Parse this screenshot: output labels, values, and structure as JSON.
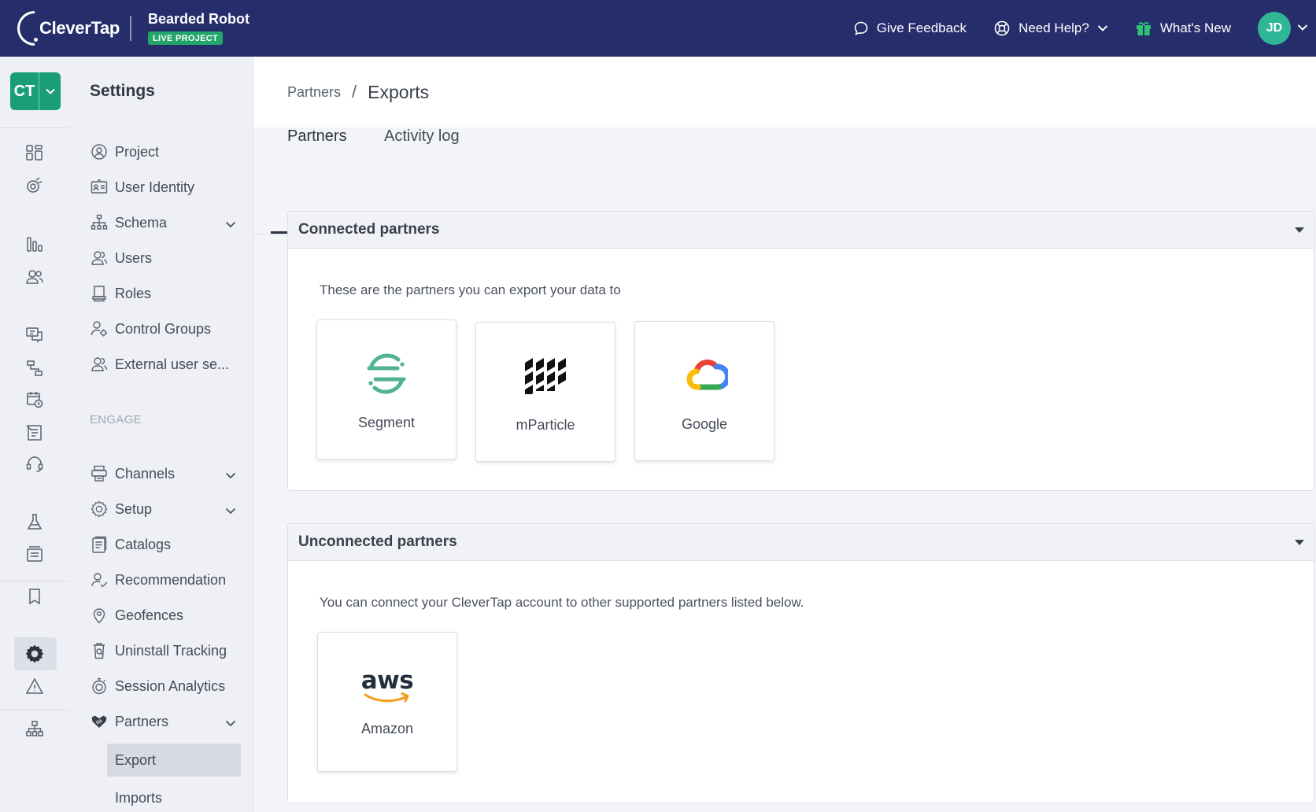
{
  "header": {
    "brand": "CleverTap",
    "project_name": "Bearded Robot",
    "project_badge": "LIVE PROJECT",
    "feedback_label": "Give Feedback",
    "help_label": "Need Help?",
    "whats_new_label": "What's New",
    "avatar_initials": "JD"
  },
  "rail": {
    "account_switch": "CT",
    "icons": [
      "dashboard-icon",
      "segments-icon",
      "analytics-icon",
      "users-icon",
      "messages-icon",
      "journeys-icon",
      "campaign-calendar-icon",
      "campaigns-icon",
      "support-icon",
      "experiments-icon",
      "catalog-icon",
      "bookmark-icon",
      "settings-icon",
      "alert-icon",
      "hierarchy-icon"
    ],
    "active_icon": "settings-icon"
  },
  "sidebar": {
    "title": "Settings",
    "items": [
      {
        "label": "Project",
        "icon": "project-icon"
      },
      {
        "label": "User Identity",
        "icon": "id-card-icon"
      },
      {
        "label": "Schema",
        "icon": "schema-icon",
        "expandable": true
      },
      {
        "label": "Users",
        "icon": "users-icon"
      },
      {
        "label": "Roles",
        "icon": "roles-icon"
      },
      {
        "label": "Control Groups",
        "icon": "control-groups-icon"
      },
      {
        "label": "External user se...",
        "icon": "external-users-icon"
      }
    ],
    "section_engage": "ENGAGE",
    "engage_items": [
      {
        "label": "Channels",
        "icon": "channels-icon",
        "expandable": true
      },
      {
        "label": "Setup",
        "icon": "gear-icon",
        "expandable": true
      },
      {
        "label": "Catalogs",
        "icon": "catalogs-icon"
      },
      {
        "label": "Recommendation",
        "icon": "recommendation-icon"
      },
      {
        "label": "Geofences",
        "icon": "location-pin-icon"
      },
      {
        "label": "Uninstall Tracking",
        "icon": "uninstall-icon"
      },
      {
        "label": "Session Analytics",
        "icon": "stopwatch-icon"
      },
      {
        "label": "Partners",
        "icon": "handshake-icon",
        "expandable": true
      }
    ],
    "partner_subitems": [
      {
        "label": "Export",
        "active": true
      },
      {
        "label": "Imports",
        "active": false
      }
    ]
  },
  "main": {
    "breadcrumb_parent": "Partners",
    "breadcrumb_sep": "/",
    "breadcrumb_current": "Exports",
    "tabs": [
      {
        "label": "Partners",
        "active": true
      },
      {
        "label": "Activity log",
        "active": false
      }
    ],
    "connected": {
      "title": "Connected partners",
      "description": "These are the partners you can export your data to",
      "partners": [
        {
          "name": "Segment",
          "logo": "segment-logo"
        },
        {
          "name": "mParticle",
          "logo": "mparticle-logo"
        },
        {
          "name": "Google",
          "logo": "google-cloud-logo"
        }
      ]
    },
    "unconnected": {
      "title": "Unconnected partners",
      "description": "You can connect your CleverTap account to other supported partners listed below.",
      "partners": [
        {
          "name": "Amazon",
          "logo": "aws-logo"
        }
      ],
      "aws_wordmark": "aws"
    }
  },
  "colors": {
    "topbar": "#262d6b",
    "brand_green": "#1a9e75",
    "live_badge": "#22a66a",
    "avatar": "#2eb696",
    "sidebar_bg": "#eef0f5"
  }
}
